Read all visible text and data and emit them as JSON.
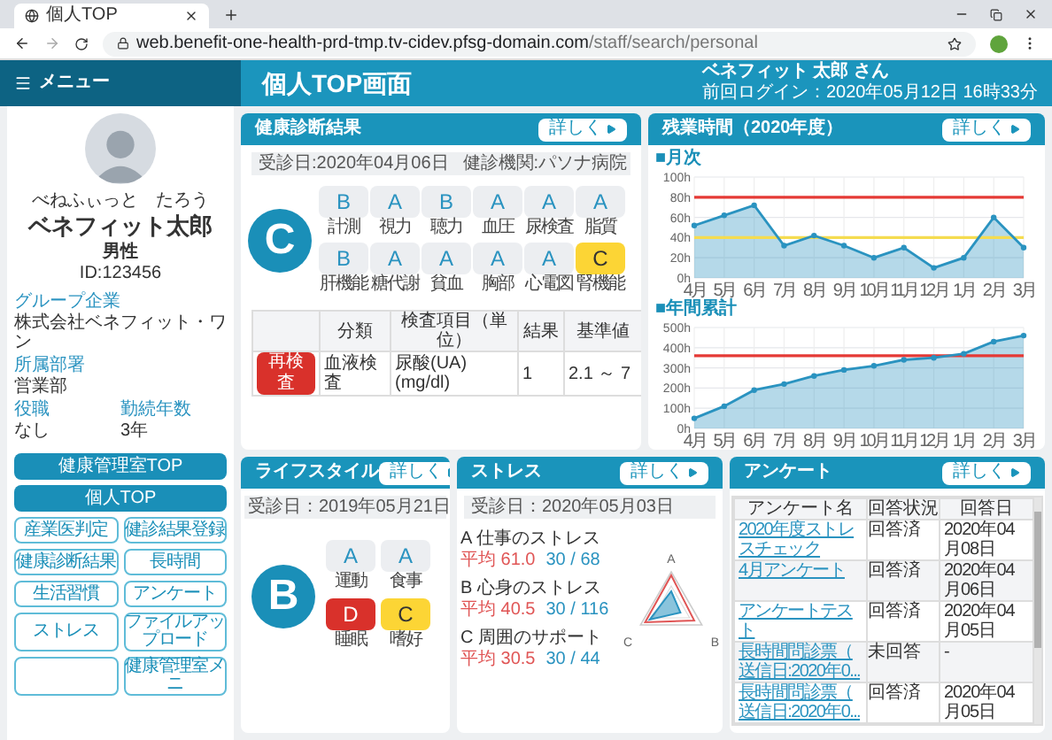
{
  "browser": {
    "tab_title": "個人TOP",
    "url_host": "web.benefit-one-health-prd-tmp.tv-cidev.pfsg-domain.com",
    "url_path": "/staff/search/personal"
  },
  "header": {
    "menu_label": "メニュー",
    "page_title": "個人TOP画面",
    "user_name": "ベネフィット 太郎 さん",
    "last_login": "前回ログイン：2020年05月12日 16時33分"
  },
  "profile": {
    "reading_family": "べねふぃっと",
    "reading_given": "たろう",
    "family_name": "ベネフィット",
    "given_name": "太郎",
    "gender": "男性",
    "id": "ID:123456",
    "fields": [
      {
        "label": "グループ企業",
        "value": "株式会社ベネフィット・ワン"
      },
      {
        "label": "所属部署",
        "value": "営業部"
      }
    ],
    "pair": [
      {
        "label": "役職",
        "value": "なし"
      },
      {
        "label": "勤続年数",
        "value": "3年"
      }
    ]
  },
  "nav_buttons": [
    {
      "label": "健康管理室TOP",
      "kind": "primary"
    },
    {
      "label": "個人TOP",
      "kind": "primary"
    },
    {
      "label": "産業医判定",
      "kind": "outline"
    },
    {
      "label": "健診結果登録",
      "kind": "outline"
    },
    {
      "label": "健康診断結果",
      "kind": "outline"
    },
    {
      "label": "長時間",
      "kind": "outline"
    },
    {
      "label": "生活習慣",
      "kind": "outline"
    },
    {
      "label": "アンケート",
      "kind": "outline"
    },
    {
      "label": "ストレス",
      "kind": "outline"
    },
    {
      "label": "ファイルアップロード",
      "kind": "outline"
    },
    {
      "kind": "outline"
    },
    {
      "label": "健康管理室メニ",
      "kind": "outline"
    }
  ],
  "health": {
    "title": "健康診断結果",
    "detail_button": "詳しく",
    "exam_date": "受診日:2020年04月06日",
    "facility": "健診機関:パソナ病院",
    "overall": "C",
    "grades": [
      {
        "grade": "B",
        "label": "計測",
        "kind": "normal"
      },
      {
        "grade": "A",
        "label": "視力",
        "kind": "normal"
      },
      {
        "grade": "B",
        "label": "聴力",
        "kind": "normal"
      },
      {
        "grade": "A",
        "label": "血圧",
        "kind": "normal"
      },
      {
        "grade": "A",
        "label": "尿検査",
        "kind": "normal"
      },
      {
        "grade": "A",
        "label": "脂質",
        "kind": "normal"
      },
      {
        "grade": "B",
        "label": "肝機能",
        "kind": "normal"
      },
      {
        "grade": "A",
        "label": "糖代謝",
        "kind": "normal"
      },
      {
        "grade": "A",
        "label": "貧血",
        "kind": "normal"
      },
      {
        "grade": "A",
        "label": "胸部",
        "kind": "normal"
      },
      {
        "grade": "A",
        "label": "心電図",
        "kind": "normal"
      },
      {
        "grade": "C",
        "label": "腎機能",
        "kind": "warning"
      }
    ],
    "table": {
      "columns": [
        "分類",
        "検査項目（単位）",
        "結果",
        "基準値"
      ],
      "rows": [
        {
          "badge": "再検査",
          "cells": [
            "血液検査",
            "尿酸(UA)(mg/dl)",
            "1",
            "2.1 ～ 7"
          ]
        }
      ]
    }
  },
  "overtime": {
    "title": "残業時間（2020年度）",
    "detail_button": "詳しく",
    "charts": [
      {
        "heading": "■月次",
        "chart_data": {
          "type": "area",
          "categories": [
            "4月",
            "5月",
            "6月",
            "7月",
            "8月",
            "9月",
            "10月",
            "11月",
            "12月",
            "1月",
            "2月",
            "3月"
          ],
          "series": [
            {
              "color": "#2a93c0",
              "values": [
                52,
                62,
                72,
                32,
                42,
                32,
                20,
                30,
                10,
                20,
                60,
                30
              ]
            }
          ],
          "grid": true,
          "ylim": [
            0,
            100
          ],
          "yticks": [
            {
              "value": 0,
              "label": "0h"
            },
            {
              "value": 20,
              "label": "20h"
            },
            {
              "value": 40,
              "label": "40h"
            },
            {
              "value": 60,
              "label": "60h"
            },
            {
              "value": 80,
              "label": "80h"
            },
            {
              "value": 100,
              "label": "100h"
            }
          ],
          "ref_lines": [
            {
              "axis": "y",
              "value": 80,
              "color": "#e53935"
            },
            {
              "axis": "y",
              "value": 40,
              "color": "#f5dc50"
            }
          ]
        }
      },
      {
        "heading": "■年間累計",
        "chart_data": {
          "type": "area",
          "categories": [
            "4月",
            "5月",
            "6月",
            "7月",
            "8月",
            "9月",
            "10月",
            "11月",
            "12月",
            "1月",
            "2月",
            "3月"
          ],
          "series": [
            {
              "color": "#2a93c0",
              "values": [
                50,
                110,
                190,
                220,
                260,
                290,
                310,
                340,
                350,
                370,
                430,
                460
              ]
            }
          ],
          "grid": true,
          "ylim": [
            0,
            500
          ],
          "yticks": [
            {
              "value": 0,
              "label": "0h"
            },
            {
              "value": 100,
              "label": "100h"
            },
            {
              "value": 200,
              "label": "200h"
            },
            {
              "value": 300,
              "label": "300h"
            },
            {
              "value": 400,
              "label": "400h"
            },
            {
              "value": 500,
              "label": "500h"
            }
          ],
          "ref_lines": [
            {
              "axis": "y",
              "value": 360,
              "color": "#e53935"
            }
          ]
        }
      }
    ]
  },
  "lifestyle": {
    "title": "ライフスタイル",
    "detail_button": "詳しく",
    "exam_date": "受診日：2019年05月21日",
    "overall": "B",
    "grades": [
      {
        "grade": "A",
        "label": "運動",
        "kind": "normal"
      },
      {
        "grade": "A",
        "label": "食事",
        "kind": "normal"
      },
      {
        "grade": "D",
        "label": "睡眠",
        "kind": "alert"
      },
      {
        "grade": "C",
        "label": "嗜好",
        "kind": "warning"
      }
    ]
  },
  "stress": {
    "title": "ストレス",
    "detail_button": "詳しく",
    "exam_date": "受診日：2020年05月03日",
    "items": [
      {
        "label": "A 仕事のストレス",
        "average": "平均 61.0",
        "score": "30 / 68"
      },
      {
        "label": "B 心身のストレス",
        "average": "平均 40.5",
        "score": "30 / 116"
      },
      {
        "label": "C 周囲のサポート",
        "average": "平均 30.5",
        "score": "30 / 44"
      }
    ],
    "axes": [
      "A",
      "B",
      "C"
    ]
  },
  "survey": {
    "title": "アンケート",
    "detail_button": "詳しく",
    "columns": [
      "アンケート名",
      "回答状況",
      "回答日"
    ],
    "rows": [
      {
        "name": "2020年度ストレスチェック",
        "status": "回答済",
        "date": "2020年04月08日"
      },
      {
        "name": "4月アンケート",
        "status": "回答済",
        "date": "2020年04月06日"
      },
      {
        "name": "アンケートテスト",
        "status": "回答済",
        "date": "2020年04月05日"
      },
      {
        "name": "長時間問診票（送信日:2020年0...",
        "status": "未回答",
        "date": "-"
      },
      {
        "name": "長時間問診票（送信日:2020年0...",
        "status": "回答済",
        "date": "2020年04月05日"
      }
    ]
  }
}
